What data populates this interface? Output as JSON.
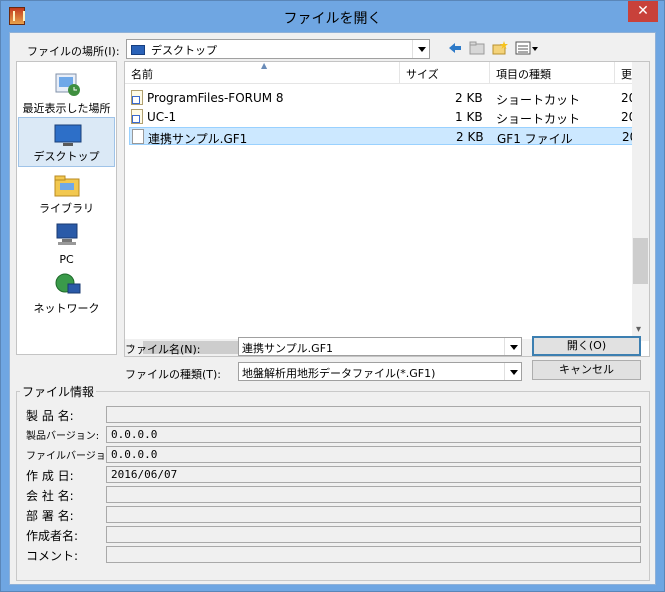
{
  "window": {
    "title": "ファイルを開く",
    "close_glyph": "✕"
  },
  "toolbar": {
    "lookin_label": "ファイルの場所(I):",
    "lookin_value": "デスクトップ",
    "icons": [
      "back-arrow-icon",
      "up-folder-icon",
      "new-folder-icon",
      "view-menu-icon"
    ]
  },
  "places": [
    {
      "label": "最近表示した場所",
      "icon": "recent-places-icon"
    },
    {
      "label": "デスクトップ",
      "icon": "desktop-icon",
      "selected": true
    },
    {
      "label": "ライブラリ",
      "icon": "libraries-icon"
    },
    {
      "label": "PC",
      "icon": "computer-icon"
    },
    {
      "label": "ネットワーク",
      "icon": "network-icon"
    }
  ],
  "filelist": {
    "columns": [
      "名前",
      "サイズ",
      "項目の種類",
      "更"
    ],
    "rows": [
      {
        "name": "ProgramFiles-FORUM 8",
        "size": "2 KB",
        "type": "ショートカット",
        "date": "20"
      },
      {
        "name": "UC-1",
        "size": "1 KB",
        "type": "ショートカット",
        "date": "20"
      },
      {
        "name": "連携サンプル.GF1",
        "size": "2 KB",
        "type": "GF1 ファイル",
        "date": "20",
        "selected": true
      }
    ]
  },
  "form": {
    "filename_label": "ファイル名(N):",
    "filename_value": "連携サンプル.GF1",
    "filetype_label": "ファイルの種類(T):",
    "filetype_value": "地盤解析用地形データファイル(*.GF1)",
    "open_button": "開く(O)",
    "cancel_button": "キャンセル"
  },
  "info": {
    "title": "ファイル情報",
    "rows": [
      {
        "label": "製 品 名:",
        "value": ""
      },
      {
        "label": "製品バージョン:",
        "value": "0.0.0.0"
      },
      {
        "label": "ファイルバージョン:",
        "value": "0.0.0.0"
      },
      {
        "label": "作 成 日:",
        "value": "2016/06/07"
      },
      {
        "label": "会 社 名:",
        "value": ""
      },
      {
        "label": "部 署 名:",
        "value": ""
      },
      {
        "label": "作成者名:",
        "value": ""
      },
      {
        "label": "コメント:",
        "value": ""
      }
    ]
  }
}
